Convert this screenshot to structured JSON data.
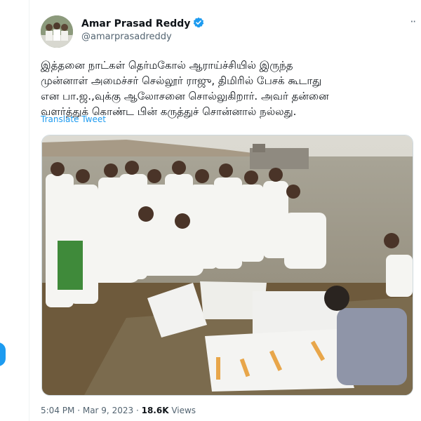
{
  "author": {
    "name": "Amar Prasad Reddy",
    "handle": "@amarprasadreddy",
    "verified": true,
    "avatar_icon": "profile-photo"
  },
  "tweet": {
    "lines": [
      "இத்தனை நாட்கள் தெர்மகோல் ஆராய்ச்சியில் இருந்த",
      "முன்னாள் அமைச்சர் செல்லூர் ராஜு, திமிரில் பேசக் கூடாது",
      "என பா.ஜ.,வுக்கு ஆலோசனை சொல்லுகிறார். அவர் தன்னை",
      "வளர்த்துக் கொண்ட பின் கருத்துச் சொன்னால் நல்லது."
    ],
    "translate_label": "Translate Tweet",
    "image_icon": "photo-men-placing-thermocol-sheets-on-reservoir"
  },
  "meta": {
    "time": "5:04 PM",
    "separator": "·",
    "date": "Mar 9, 2023",
    "views_count": "18.6K",
    "views_label": "Views"
  },
  "colors": {
    "accent": "#1d9bf0",
    "secondary_text": "#536471",
    "text": "#0f1419"
  }
}
